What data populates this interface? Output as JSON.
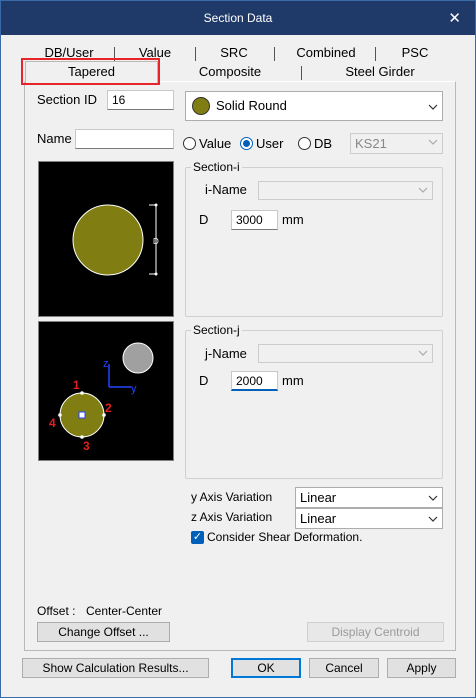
{
  "window": {
    "title": "Section Data",
    "close_symbol": "✕"
  },
  "tabs_top": [
    "DB/User",
    "Value",
    "SRC",
    "Combined",
    "PSC"
  ],
  "tabs_bottom": [
    "Tapered",
    "Composite",
    "Steel Girder"
  ],
  "section": {
    "id_label": "Section ID",
    "id_value": "16",
    "name_label": "Name",
    "name_value": "",
    "shape": "Solid Round"
  },
  "source": {
    "options": [
      "Value",
      "User",
      "DB"
    ],
    "selected": "User",
    "db_value": "KS21"
  },
  "section_i": {
    "title": "Section-i",
    "name_label": "i-Name",
    "name_value": "",
    "d_label": "D",
    "d_value": "3000",
    "unit": "mm"
  },
  "section_j": {
    "title": "Section-j",
    "name_label": "j-Name",
    "name_value": "",
    "d_label": "D",
    "d_value": "2000",
    "unit": "mm"
  },
  "preview_top": {
    "dim_label": "D"
  },
  "preview_bottom": {
    "axis_z": "z",
    "axis_y": "y",
    "points": [
      "1",
      "2",
      "3",
      "4"
    ]
  },
  "variation": {
    "y_label": "y Axis Variation",
    "y_value": "Linear",
    "z_label": "z Axis Variation",
    "z_value": "Linear",
    "shear_label": "Consider Shear Deformation.",
    "shear_checked": true
  },
  "offset": {
    "label": "Offset :",
    "value": "Center-Center",
    "change_button": "Change Offset ...",
    "display_centroid": "Display Centroid"
  },
  "footer": {
    "show_calc": "Show Calculation Results...",
    "ok": "OK",
    "cancel": "Cancel",
    "apply": "Apply"
  },
  "colors": {
    "accent": "#005fb8",
    "highlight": "#e8242b",
    "section_fill": "#807d12",
    "title_bar": "#1f3a68"
  }
}
